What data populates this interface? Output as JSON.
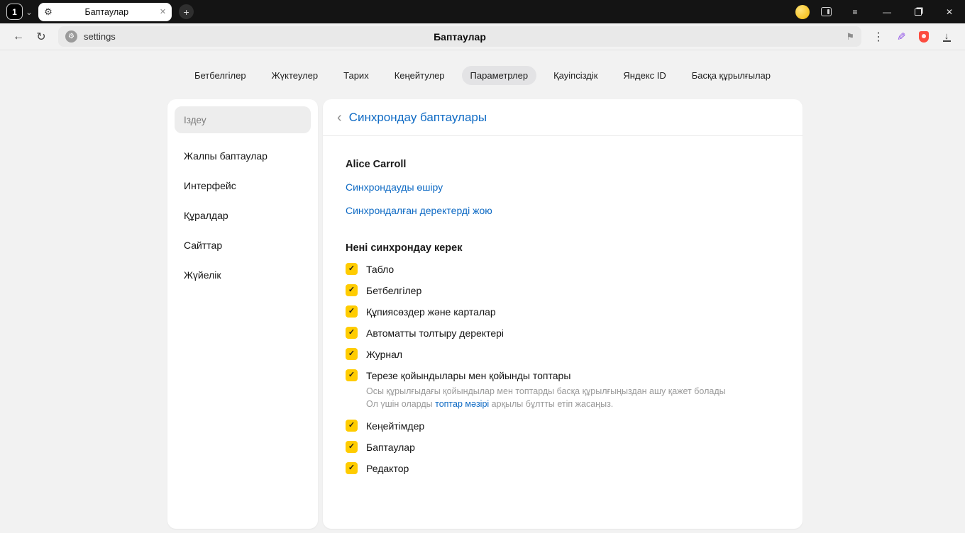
{
  "colors": {
    "accent_blue": "#0e6ac4",
    "checkbox_yellow": "#ffcc00",
    "protect_red": "#fc4c3f",
    "pen_purple": "#8f4fe8",
    "titlebar_bg": "#141414",
    "page_bg": "#f2f2f2"
  },
  "icons": {
    "chevron_down": "⌄",
    "gear": "⚙",
    "close_tab": "✕",
    "plus": "+",
    "hamburger": "≡",
    "minimize": "—",
    "close_window": "✕",
    "back": "←",
    "reload": "↻",
    "site": "⚙",
    "bookmark": "⚑",
    "kebab": "⋮",
    "pen": "✎",
    "download_arrow": "↓",
    "back_chevron": "‹",
    "check": "✓"
  },
  "window": {
    "tab_count": "1",
    "tab_title": "Баптаулар"
  },
  "toolbar": {
    "url": "settings",
    "page_title": "Баптаулар"
  },
  "nav": {
    "tabs": [
      "Бетбелгілер",
      "Жүктеулер",
      "Тарих",
      "Кеңейтулер",
      "Параметрлер",
      "Қауіпсіздік",
      "Яндекс ID",
      "Басқа құрылғылар"
    ],
    "active": "Параметрлер"
  },
  "sidebar": {
    "search_placeholder": "Іздеу",
    "items": [
      "Жалпы баптаулар",
      "Интерфейс",
      "Құралдар",
      "Сайттар",
      "Жүйелік"
    ]
  },
  "content": {
    "title": "Синхрондау баптаулары",
    "account_name": "Alice Carroll",
    "link_disable_sync": "Синхрондауды өшіру",
    "link_delete_data": "Синхрондалған деректерді жою",
    "section_title": "Нені синхрондау керек",
    "checkboxes": [
      {
        "label": "Табло",
        "checked": true
      },
      {
        "label": "Бетбелгілер",
        "checked": true
      },
      {
        "label": "Құпиясөздер және карталар",
        "checked": true
      },
      {
        "label": "Автоматты толтыру деректері",
        "checked": true
      },
      {
        "label": "Журнал",
        "checked": true
      },
      {
        "label": "Терезе қойындылары мен қойынды топтары",
        "checked": true,
        "note_line1": "Осы құрылғыдағы қойындылар мен топтарды басқа құрылғыңыздан ашу қажет болады",
        "note_line2_prefix": "Ол үшін оларды ",
        "note_link": "топтар мәзірі",
        "note_line2_suffix": " арқылы бұлтты етіп жасаңыз."
      },
      {
        "label": "Кеңейтімдер",
        "checked": true
      },
      {
        "label": "Баптаулар",
        "checked": true
      },
      {
        "label": "Редактор",
        "checked": true
      }
    ]
  }
}
